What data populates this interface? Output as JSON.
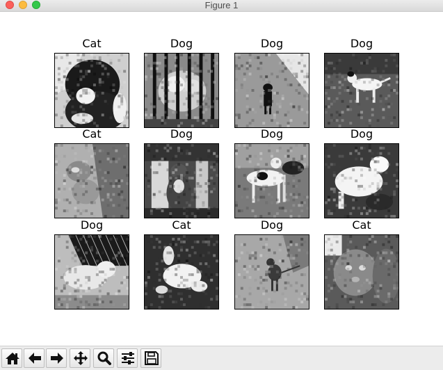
{
  "window": {
    "title": "Figure 1"
  },
  "figure": {
    "panels": [
      {
        "label": "Cat",
        "scene": "dark-cat-closeup"
      },
      {
        "label": "Dog",
        "scene": "cat-behind-bars"
      },
      {
        "label": "Dog",
        "scene": "small-dark-dog-on-ground"
      },
      {
        "label": "Dog",
        "scene": "white-dog-on-grass"
      },
      {
        "label": "Cat",
        "scene": "tabby-kitten-on-blanket"
      },
      {
        "label": "Dog",
        "scene": "cat-sitting-in-doorway"
      },
      {
        "label": "Dog",
        "scene": "spotted-dogs-standing"
      },
      {
        "label": "Dog",
        "scene": "white-cat-lying"
      },
      {
        "label": "Dog",
        "scene": "cat-sleeping-by-zebra-fabric"
      },
      {
        "label": "Cat",
        "scene": "white-cat-rolling"
      },
      {
        "label": "Dog",
        "scene": "small-dog-walking"
      },
      {
        "label": "Cat",
        "scene": "fluffy-cat-face"
      }
    ]
  },
  "toolbar": {
    "tools": [
      {
        "name": "home-icon",
        "tooltip": "Reset original view"
      },
      {
        "name": "back-icon",
        "tooltip": "Back to previous view"
      },
      {
        "name": "forward-icon",
        "tooltip": "Forward to next view"
      },
      {
        "name": "pan-icon",
        "tooltip": "Pan axes"
      },
      {
        "name": "zoom-icon",
        "tooltip": "Zoom to rectangle"
      },
      {
        "name": "configure-subplots-icon",
        "tooltip": "Configure subplots"
      },
      {
        "name": "save-icon",
        "tooltip": "Save the figure"
      }
    ]
  },
  "colors": {
    "titlebar": "#e3e3e3",
    "toolbar": "#ececec",
    "close": "#fc605b",
    "minimize": "#fdbc40",
    "maximize": "#34c84a"
  }
}
